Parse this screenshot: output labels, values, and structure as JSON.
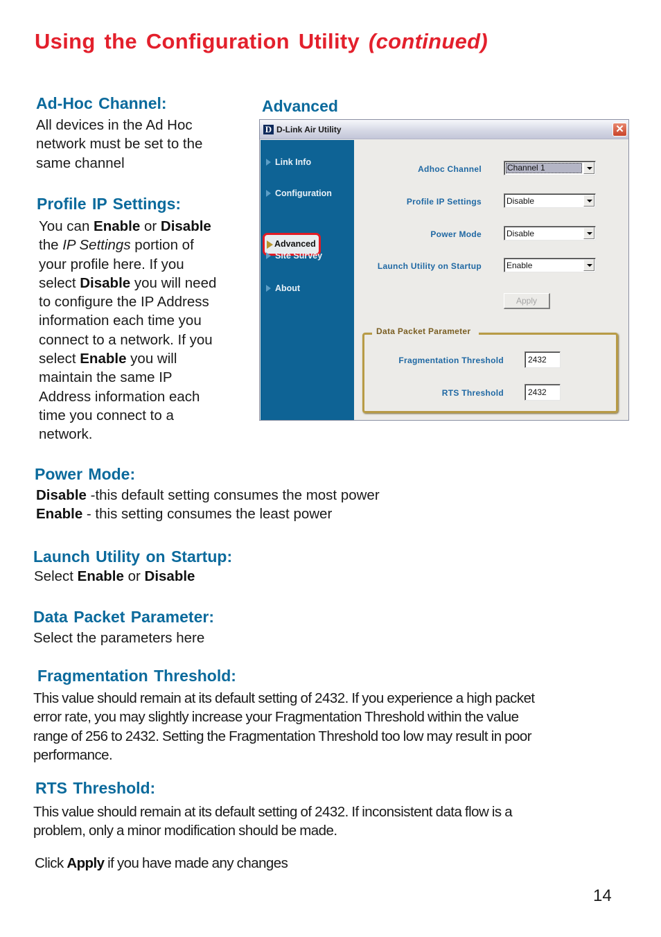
{
  "page": {
    "title": "Using the Configuration Utility",
    "title_suffix": "(continued)",
    "page_number": "14",
    "accent_color": "#e3202c",
    "heading_color": "#0b6a9c"
  },
  "sections": {
    "adhoc": {
      "heading": "Ad-Hoc Channel:",
      "lines": [
        "All devices in the Ad Hoc",
        "network must be set to the",
        "same channel"
      ]
    },
    "profile_ip": {
      "heading": "Profile IP Settings:",
      "t1": "You can ",
      "b1": "Enable",
      "t2": " or ",
      "b2": "Disable",
      "t3": "the ",
      "i1": "IP Settings",
      "t4": " portion of",
      "t5": "your profile  here. If you",
      "t6": "select ",
      "b3": "Disable",
      "t7": " you will need",
      "t8": "to configure the IP Address",
      "t9": "information each time you",
      "t10": "connect to a network. If you",
      "t11": "select ",
      "b4": "Enable",
      "t12": " you will",
      "t13": "maintain the same IP",
      "t14": "Address information  each",
      "t15": "time you connect to a",
      "t16": "network."
    },
    "power_mode": {
      "heading": "Power Mode:",
      "b1": "Disable",
      "t1": " -this default setting consumes the most power",
      "b2": "Enable",
      "t2": " - this setting consumes the least power"
    },
    "launch": {
      "heading": "Launch Utility on Startup:",
      "t1": "Select ",
      "b1": "Enable",
      "t2": " or ",
      "b2": "Disable"
    },
    "data_packet": {
      "heading": "Data Packet Parameter:",
      "text": "Select the parameters here"
    },
    "fragmentation": {
      "heading": "Fragmentation Threshold:",
      "lines": [
        "This value should remain at its default setting of 2432. If you experience a high packet",
        "error rate, you may slightly increase your Fragmentation Threshold within the value",
        "range of 256 to 2432. Setting the Fragmentation Threshold too low may result in poor",
        "performance."
      ]
    },
    "rts": {
      "heading": "RTS Threshold:",
      "lines": [
        "This value should remain at its default setting of 2432. If inconsistent data flow is a",
        "problem, only a minor modification should be made."
      ]
    },
    "apply_note": {
      "t1": "Click ",
      "b1": "Apply",
      "t2": " if you have made any changes"
    }
  },
  "screenshot": {
    "caption": "Advanced",
    "window_title": "D-Link Air Utility",
    "logo_letter": "D",
    "close_glyph": "✕",
    "nav": [
      {
        "label": "Link Info"
      },
      {
        "label": "Configuration"
      },
      {
        "label": "Advanced",
        "active": true
      },
      {
        "label": "Site Survey"
      },
      {
        "label": "About"
      }
    ],
    "fields": {
      "adhoc_channel": {
        "label": "Adhoc Channel",
        "value": "Channel 1"
      },
      "profile_ip": {
        "label": "Profile IP Settings",
        "value": "Disable"
      },
      "power_mode": {
        "label": "Power Mode",
        "value": "Disable"
      },
      "launch_startup": {
        "label": "Launch Utility on Startup",
        "value": "Enable"
      }
    },
    "apply_label": "Apply",
    "group": {
      "title": "Data Packet Parameter",
      "fragmentation": {
        "label": "Fragmentation Threshold",
        "value": "2432"
      },
      "rts": {
        "label": "RTS Threshold",
        "value": "2432"
      }
    }
  }
}
